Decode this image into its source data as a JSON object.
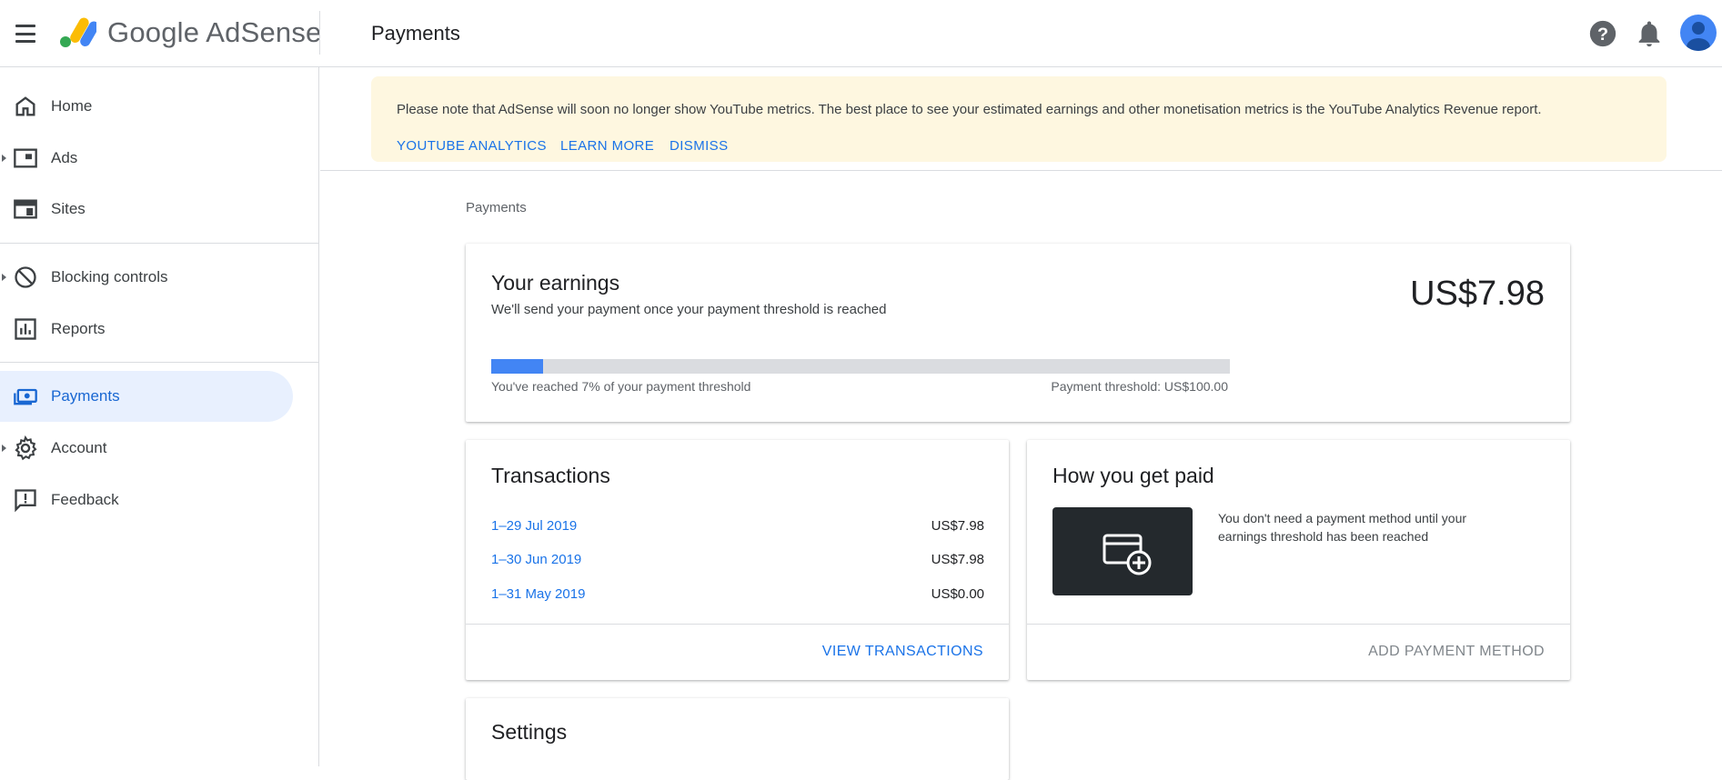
{
  "header": {
    "brand": "Google AdSense",
    "page_title": "Payments"
  },
  "sidebar": {
    "items": [
      {
        "label": "Home",
        "icon": "home-icon"
      },
      {
        "label": "Ads",
        "icon": "ads-icon"
      },
      {
        "label": "Sites",
        "icon": "sites-icon"
      },
      {
        "label": "Blocking controls",
        "icon": "block-icon"
      },
      {
        "label": "Reports",
        "icon": "bar-chart-icon"
      },
      {
        "label": "Payments",
        "icon": "payments-icon",
        "active": true
      },
      {
        "label": "Account",
        "icon": "gear-icon"
      },
      {
        "label": "Feedback",
        "icon": "feedback-icon"
      }
    ]
  },
  "banner": {
    "text": "Please note that AdSense will soon no longer show YouTube metrics. The best place to see your estimated earnings and other monetisation metrics is the YouTube Analytics Revenue report.",
    "link_youtube": "YOUTUBE ANALYTICS",
    "link_learn": "LEARN MORE",
    "link_dismiss": "DISMISS"
  },
  "breadcrumb": "Payments",
  "earnings": {
    "title": "Your earnings",
    "subtitle": "We'll send your payment once your payment threshold is reached",
    "amount": "US$7.98",
    "progress_fraction": 0.07,
    "progress_text": "You've reached 7% of your payment threshold",
    "threshold_text": "Payment threshold: US$100.00"
  },
  "transactions": {
    "title": "Transactions",
    "rows": [
      {
        "date": "1–29 Jul 2019",
        "amount": "US$7.98"
      },
      {
        "date": "1–30 Jun 2019",
        "amount": "US$7.98"
      },
      {
        "date": "1–31 May 2019",
        "amount": "US$0.00"
      }
    ],
    "action": "VIEW TRANSACTIONS"
  },
  "how_paid": {
    "title": "How you get paid",
    "text": "You don't need a payment method until your earnings threshold has been reached",
    "action": "ADD PAYMENT METHOD"
  },
  "settings": {
    "title": "Settings"
  },
  "colors": {
    "accent": "#1a73e8",
    "banner_bg": "#fef7e0",
    "active_nav_bg": "#e8f0fe",
    "progress": "#4285f4"
  }
}
